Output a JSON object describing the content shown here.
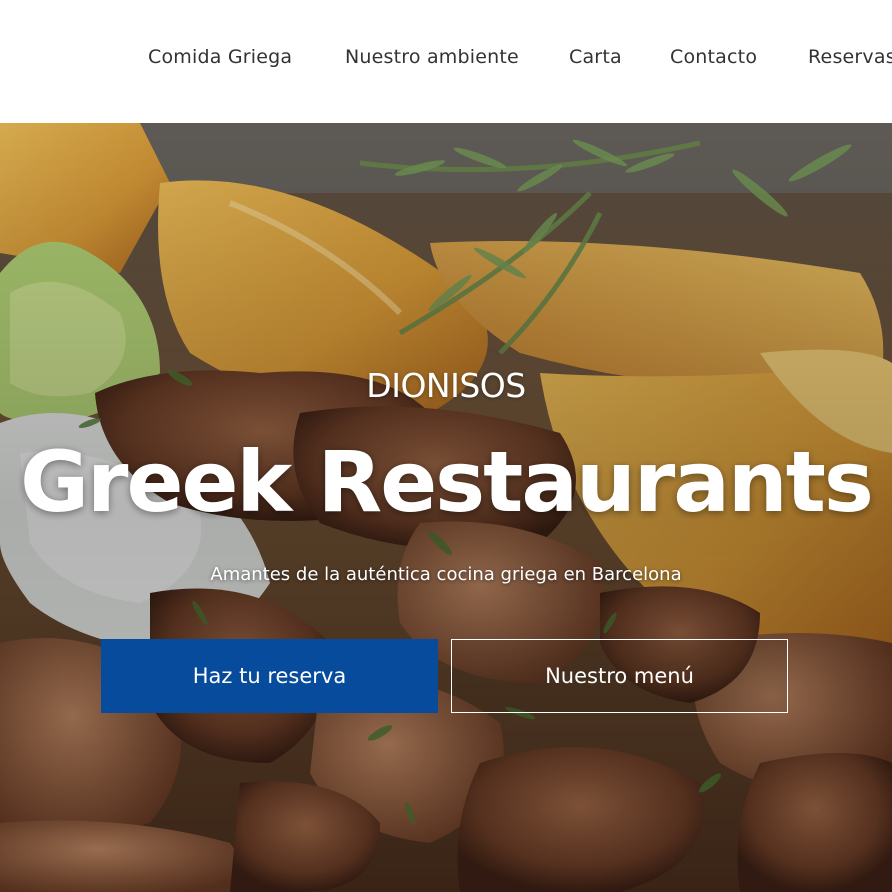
{
  "header": {
    "nav": [
      {
        "label": "Comida Griega"
      },
      {
        "label": "Nuestro ambiente"
      },
      {
        "label": "Carta"
      },
      {
        "label": "Contacto"
      },
      {
        "label": "Reservas"
      }
    ]
  },
  "hero": {
    "brand": "DIONISOS",
    "headline": "Greek Restaurants",
    "subtitle": "Amantes de la auténtica cocina griega en Barcelona",
    "primary_button": "Haz tu reserva",
    "secondary_button": "Nuestro menú",
    "image_subject": "greek-food-photo"
  },
  "colors": {
    "accent": "#074b9c",
    "nav_text": "#333333",
    "hero_text": "#ffffff"
  }
}
